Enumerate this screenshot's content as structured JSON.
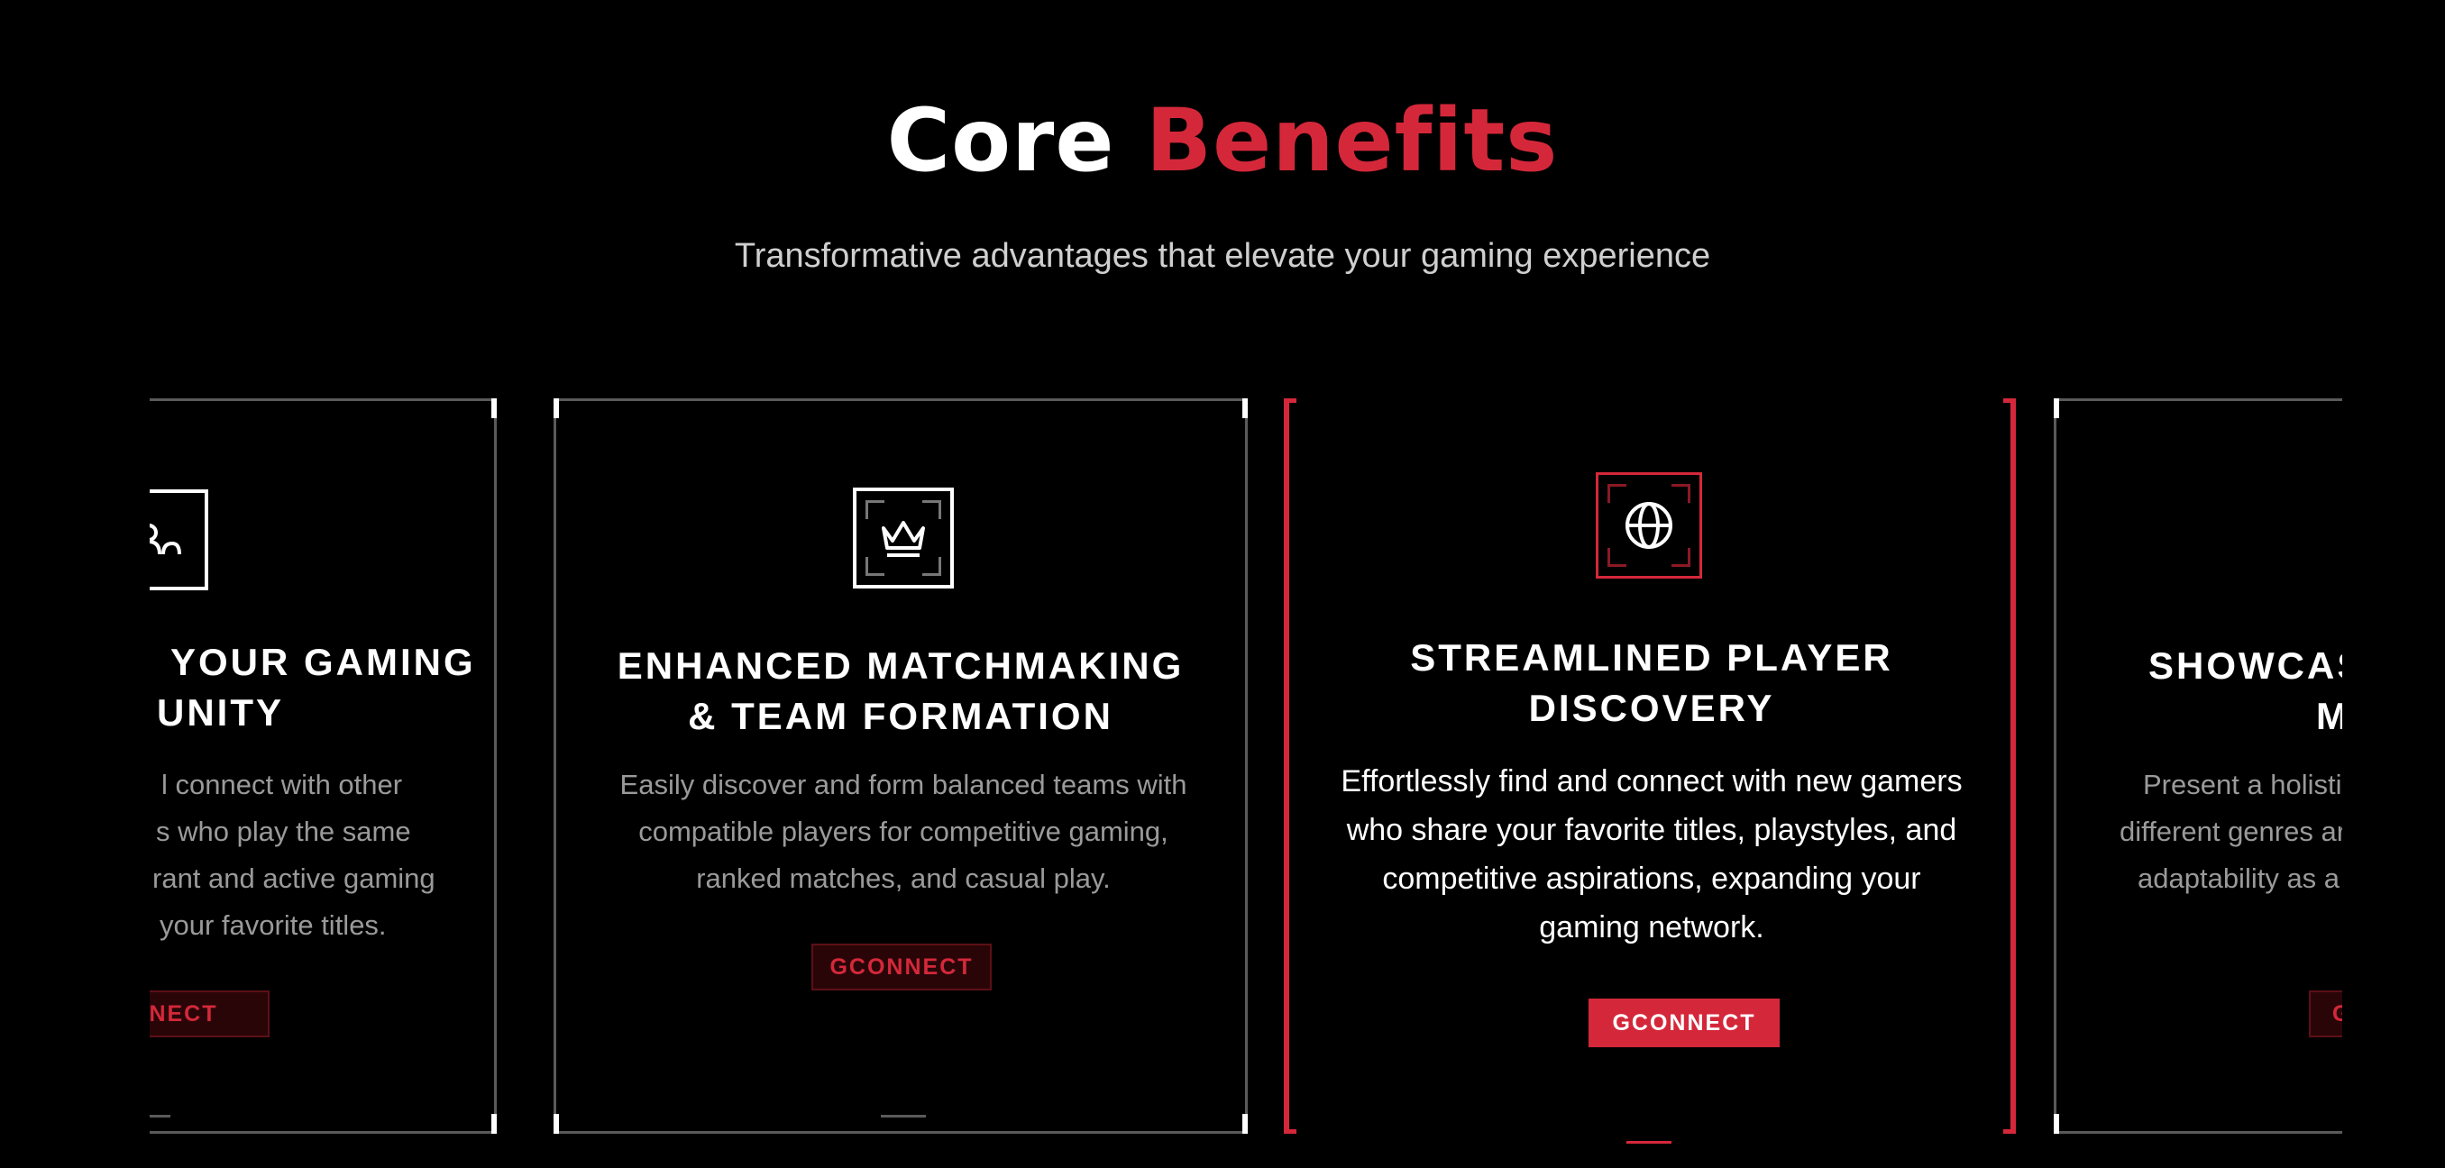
{
  "header": {
    "title_white": "Core",
    "title_red": "Benefits",
    "subtitle": "Transformative advantages that elevate your gaming experience"
  },
  "cards": [
    {
      "icon": "community-icon",
      "title_lines": [
        "YOUR GAMING",
        "UNITY"
      ],
      "desc_lines": [
        "l connect with other",
        "s who play the same",
        "rant and active gaming",
        "your favorite titles."
      ],
      "button": "INECT"
    },
    {
      "icon": "crown-icon",
      "title_lines": [
        "ENHANCED MATCHMAKING",
        "& TEAM FORMATION"
      ],
      "desc_lines": [
        "Easily discover and form balanced teams with",
        "compatible players for competitive gaming,",
        "ranked matches, and casual play."
      ],
      "button": "GCONNECT"
    },
    {
      "icon": "globe-icon",
      "title_lines": [
        "STREAMLINED PLAYER",
        "DISCOVERY"
      ],
      "desc_lines": [
        "Effortlessly find and connect with new gamers",
        "who share your favorite titles, playstyles, and",
        "competitive aspirations, expanding your",
        "gaming network."
      ],
      "button": "GCONNECT"
    },
    {
      "icon": "showcase-icon",
      "title_lines": [
        "SHOWCAS",
        "M"
      ],
      "desc_lines": [
        "Present a holistic",
        "different genres ar",
        "adaptability as a g"
      ],
      "button": "G"
    }
  ],
  "colors": {
    "accent": "#d4283a",
    "background": "#000000",
    "border": "#5a5a5a"
  }
}
